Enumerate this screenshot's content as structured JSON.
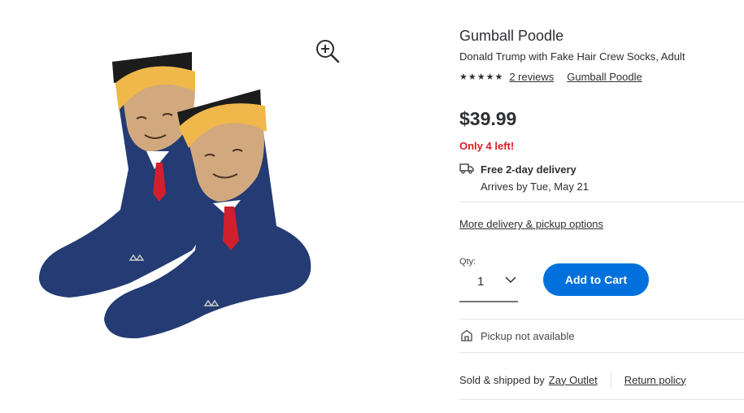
{
  "product": {
    "brand": "Gumball Poodle",
    "title": "Donald Trump with Fake Hair Crew Socks, Adult",
    "stars": "★★★★★",
    "reviews_label": "2 reviews",
    "brand_link": "Gumball Poodle",
    "price": "$39.99",
    "stock_label": "Only 4 left!"
  },
  "delivery": {
    "title": "Free 2-day delivery",
    "arrives": "Arrives by Tue, May 21",
    "more_options": "More delivery & pickup options"
  },
  "purchase": {
    "qty_label": "Qty:",
    "qty_value": "1",
    "add_to_cart": "Add to Cart"
  },
  "pickup": {
    "label": "Pickup not available"
  },
  "seller": {
    "sold_by_label": "Sold & shipped by",
    "name": "Zay Outlet",
    "return_policy": "Return policy"
  },
  "colors": {
    "accent": "#0071dc",
    "stock_red": "#de1c24",
    "text": "#2e2f32",
    "sock_navy": "#243b73"
  },
  "icons": {
    "zoom": "zoom-in-icon",
    "truck": "truck-icon",
    "store": "store-icon",
    "chevron": "chevron-down-icon"
  }
}
